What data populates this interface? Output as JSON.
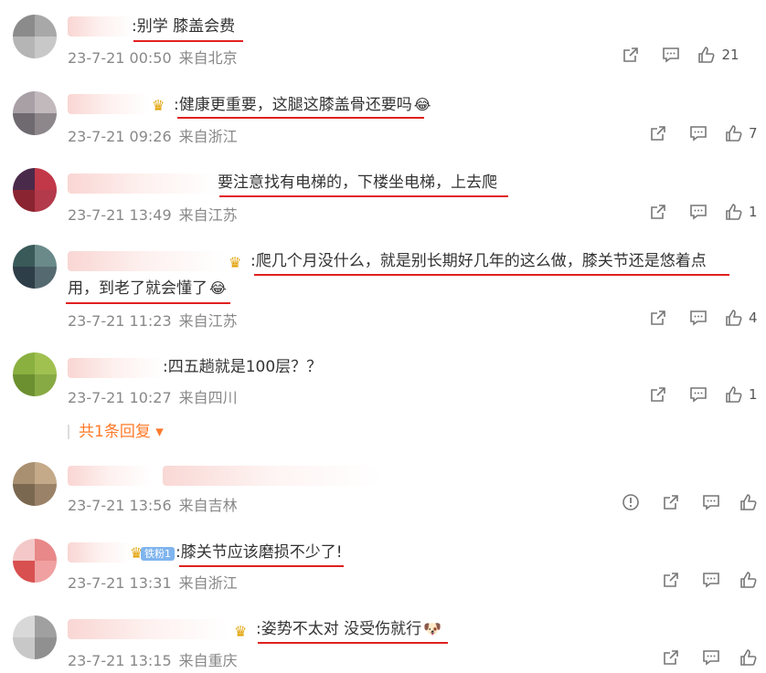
{
  "colors": {
    "accent": "#ff7a2a",
    "underline": "#e02020",
    "meta": "#888888",
    "fan_badge": "#7fb4ee"
  },
  "icons": {
    "share": "share-icon",
    "comment": "comment-icon",
    "like": "like-icon",
    "report": "report-icon"
  },
  "comments": [
    {
      "text": ":别学 膝盖会费",
      "time": "23-7-21 00:50",
      "location": "来自北京",
      "likes": "21"
    },
    {
      "text": ":健康更重要，这腿这膝盖骨还要吗",
      "emoji": "😂",
      "time": "23-7-21 09:26",
      "location": "来自浙江",
      "likes": "7"
    },
    {
      "text": "要注意找有电梯的，下楼坐电梯，上去爬",
      "time": "23-7-21 13:49",
      "location": "来自江苏",
      "likes": "1"
    },
    {
      "text_line1": ":爬几个月没什么，就是别长期好几年的这么做，膝关节还是悠着点",
      "text_line2": "用，到老了就会懂了",
      "emoji": "😂",
      "time": "23-7-21 11:23",
      "location": "来自江苏",
      "likes": "4"
    },
    {
      "text": ":四五趟就是100层？？",
      "time": "23-7-21 10:27",
      "location": "来自四川",
      "likes": "1",
      "replies": "共1条回复"
    },
    {
      "time": "23-7-21 13:56",
      "location": "来自吉林",
      "likes": ""
    },
    {
      "badge": "铁粉1",
      "text": ":膝关节应该磨损不少了!",
      "time": "23-7-21 13:31",
      "location": "来自浙江",
      "likes": ""
    },
    {
      "text": ":姿势不太对 没受伤就行",
      "emoji": "🐶",
      "time": "23-7-21 13:15",
      "location": "来自重庆",
      "likes": ""
    }
  ]
}
